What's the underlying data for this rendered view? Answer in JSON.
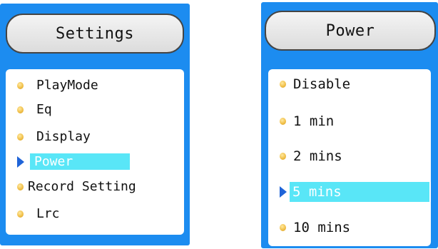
{
  "settings_screen": {
    "title": "Settings",
    "items": [
      {
        "label": "PlayMode",
        "selected": false
      },
      {
        "label": "Eq",
        "selected": false
      },
      {
        "label": "Display",
        "selected": false
      },
      {
        "label": "Power",
        "selected": true
      },
      {
        "label": "Record Setting",
        "selected": false
      },
      {
        "label": "Lrc",
        "selected": false
      }
    ]
  },
  "power_screen": {
    "title": "Power",
    "items": [
      {
        "label": "Disable",
        "selected": false
      },
      {
        "label": "1 min",
        "selected": false
      },
      {
        "label": "2 mins",
        "selected": false
      },
      {
        "label": "5 mins",
        "selected": true
      },
      {
        "label": "10 mins",
        "selected": false
      }
    ]
  },
  "colors": {
    "frame": "#1c8cf0",
    "highlight": "#59e6f7",
    "bullet": "#f1c04a",
    "pointer": "#1f64d8"
  },
  "icons": {
    "bullet": "round-bullet-icon",
    "selection": "play-triangle-icon"
  }
}
